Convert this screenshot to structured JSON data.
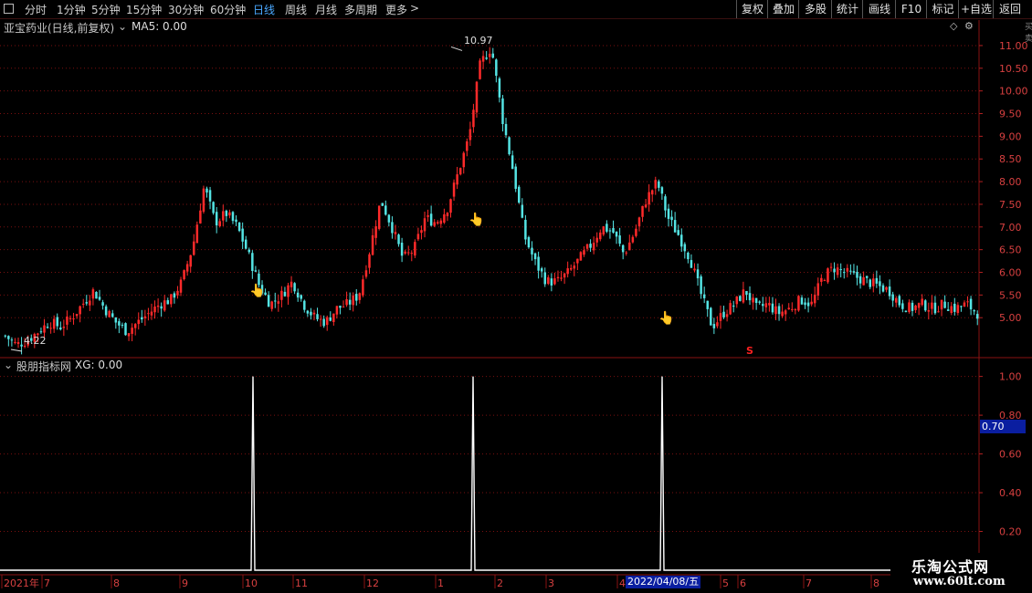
{
  "toolbar": {
    "periods": [
      "分时",
      "1分钟",
      "5分钟",
      "15分钟",
      "30分钟",
      "60分钟",
      "日线",
      "周线",
      "月线",
      "多周期",
      "更多"
    ],
    "active_period": "日线",
    "more_arrow": ">",
    "right_buttons": [
      "复权",
      "叠加",
      "多股",
      "统计",
      "画线",
      "F10",
      "标记",
      "+自选",
      "返回"
    ]
  },
  "main_panel": {
    "stock_title": "亚宝药业(日线,前复权)",
    "ma_label": "MA5: 0.00",
    "price_axis": [
      "11.00",
      "10.50",
      "10.00",
      "9.50",
      "9.00",
      "8.50",
      "8.00",
      "7.50",
      "7.00",
      "6.50",
      "6.00",
      "5.50",
      "5.00"
    ],
    "high_label": "10.97",
    "low_label": "4.22",
    "signal_mark": "S"
  },
  "indicator_panel": {
    "title": "股朋指标网",
    "xg_label": "XG: 0.00",
    "axis": [
      "1.00",
      "0.80",
      "0.60",
      "0.40",
      "0.20"
    ],
    "current_value": "0.70"
  },
  "time_axis": {
    "labels": [
      "2021年",
      "7",
      "8",
      "9",
      "10",
      "11",
      "12",
      "1",
      "2",
      "3",
      "4",
      "5",
      "6",
      "7",
      "8"
    ],
    "highlight_date": "2022/04/08/五"
  },
  "watermark": {
    "title": "乐淘公式网",
    "url": "www.60lt.com"
  },
  "side_letters": "买卖",
  "colors": {
    "up": "#ff2a2a",
    "down": "#54e4e4",
    "grid": "#7a1010",
    "indicator_line": "#ffffff",
    "active_tab": "#4aa8ff"
  },
  "chart_data": {
    "type": "candlestick",
    "price_ylim": [
      4.2,
      11.2
    ],
    "close_path": [
      4.6,
      4.4,
      4.5,
      4.7,
      4.9,
      4.8,
      5.0,
      5.3,
      5.6,
      5.2,
      4.9,
      4.7,
      4.9,
      5.1,
      5.3,
      5.4,
      5.8,
      6.6,
      7.9,
      7.1,
      7.3,
      7.0,
      6.4,
      5.7,
      5.3,
      5.5,
      5.8,
      5.3,
      5.0,
      4.9,
      5.2,
      5.3,
      5.5,
      6.5,
      7.6,
      7.0,
      6.3,
      6.5,
      7.2,
      7.1,
      7.4,
      8.2,
      9.0,
      10.6,
      10.97,
      9.4,
      8.2,
      6.8,
      6.2,
      5.8,
      5.8,
      6.0,
      6.3,
      6.6,
      7.0,
      6.9,
      6.4,
      6.9,
      7.6,
      8.0,
      7.2,
      6.8,
      6.3,
      5.5,
      4.8,
      5.1,
      5.3,
      5.6,
      5.2,
      5.3,
      5.1,
      5.2,
      5.4,
      5.3,
      5.9,
      6.1,
      6.0,
      5.9,
      5.8,
      5.7,
      5.6,
      5.3,
      5.2,
      5.3,
      5.2,
      5.3,
      5.2,
      5.3,
      5.1
    ],
    "xg_signals": [
      0.0,
      1.0,
      0.0,
      1.0,
      0.0,
      1.0,
      0.0
    ],
    "xg_ylim": [
      0,
      1.05
    ]
  }
}
